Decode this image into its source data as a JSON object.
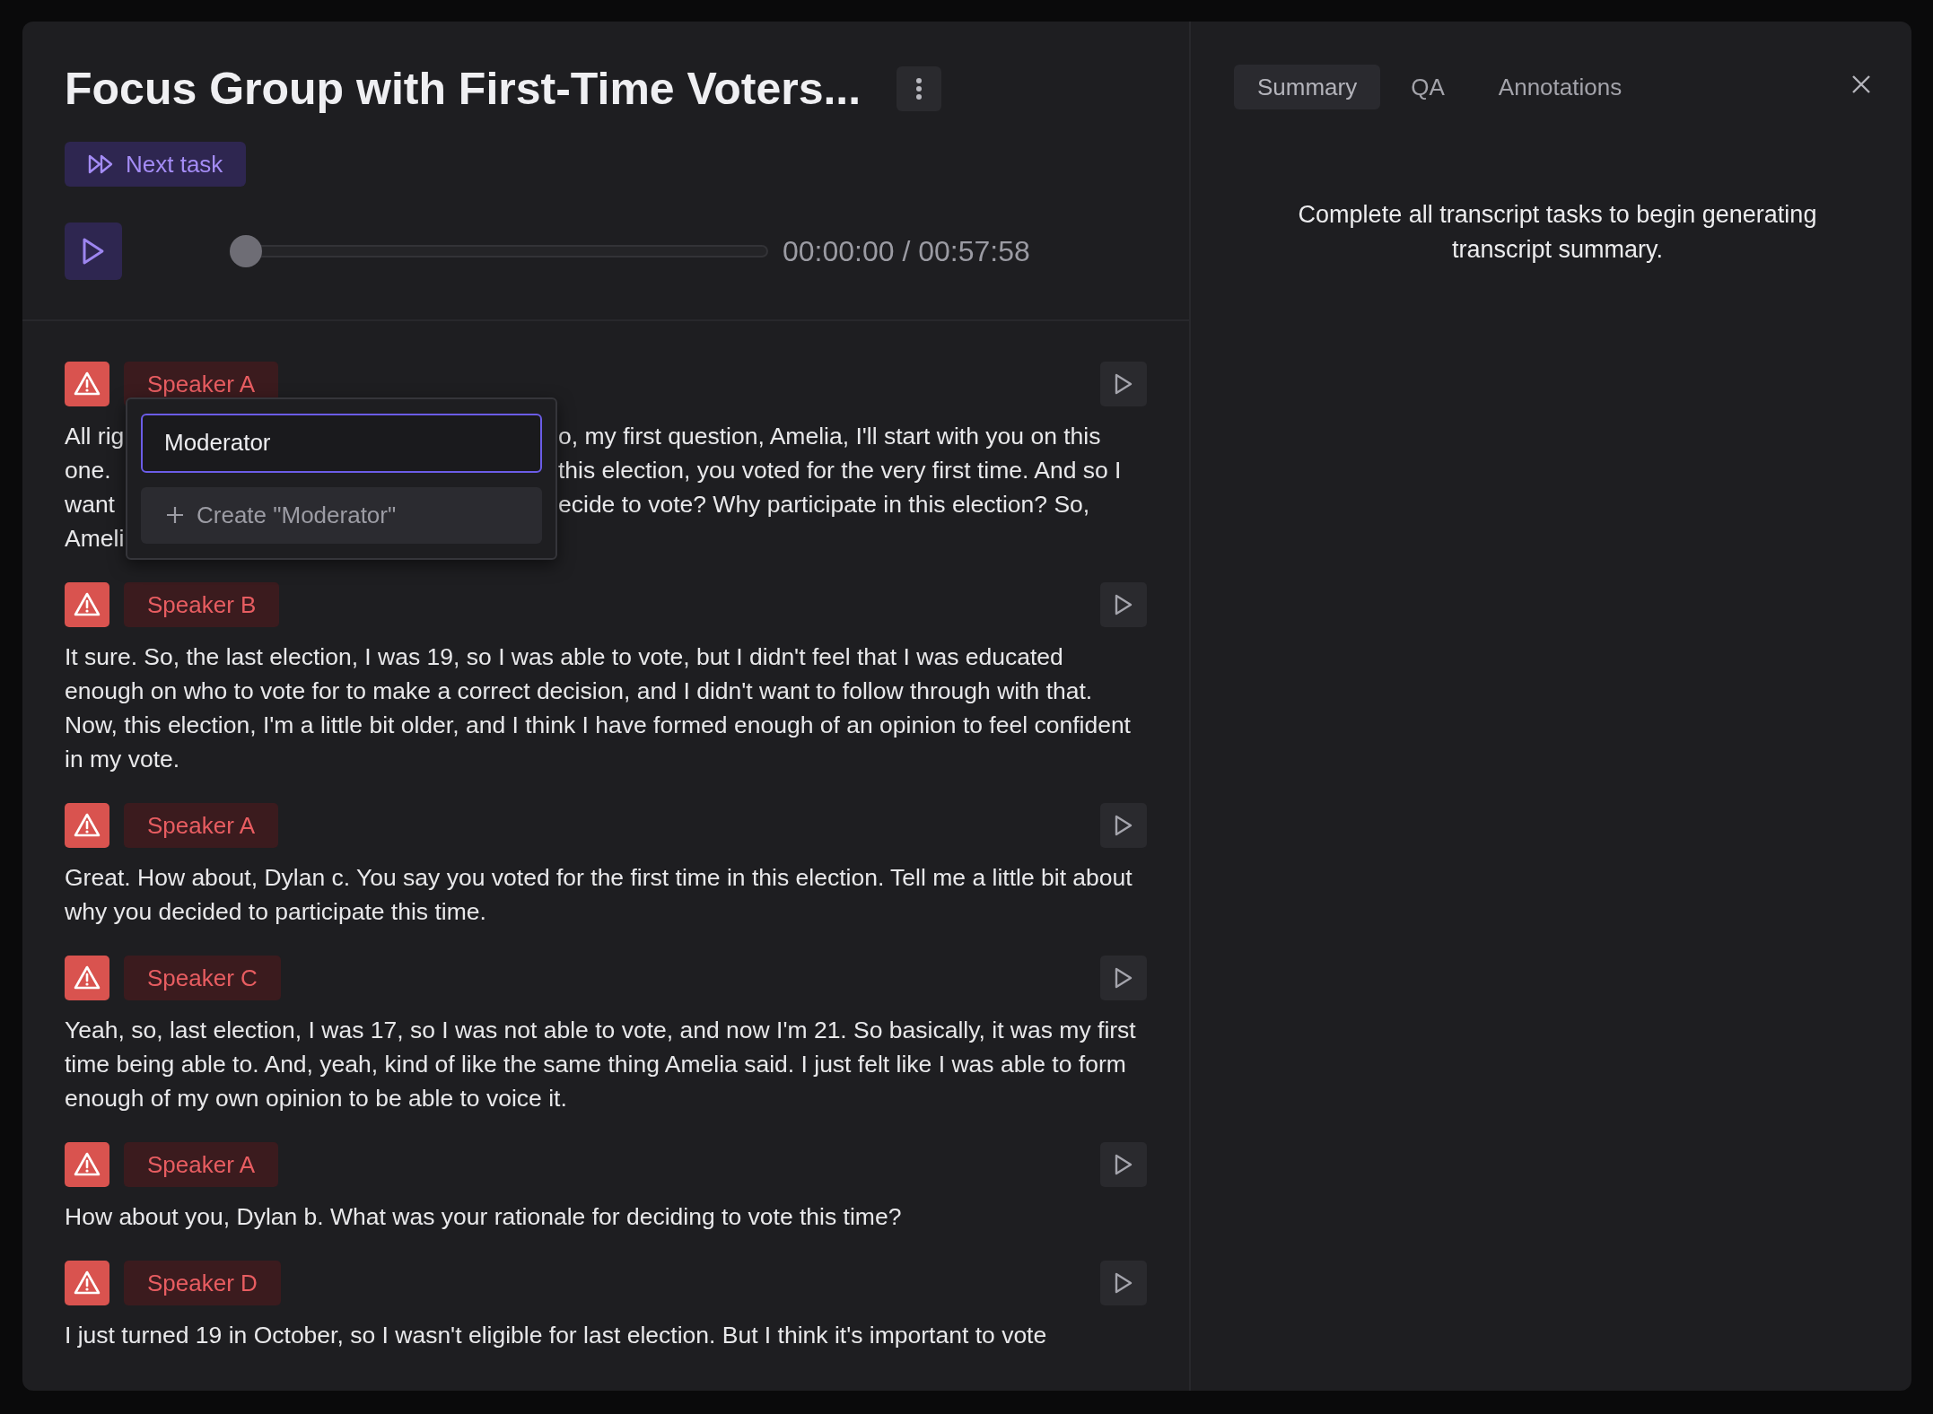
{
  "title": "Focus Group with First-Time Voters...",
  "next_task": "Next task",
  "player": {
    "level": 0,
    "time": "00:00:00 / 00:57:58"
  },
  "tabs": [
    {
      "label": "Summary",
      "selected": true
    },
    {
      "label": "QA",
      "selected": false
    },
    {
      "label": "Annotations",
      "selected": false
    }
  ],
  "summary_message": "Complete all transcript tasks to begin generating transcript summary.",
  "segments": [
    {
      "kind": "covered",
      "speaker": "Speaker A",
      "lines": [
        {
          "left": "All rig",
          "right": "o, my first question, Amelia, I'll start with you on this"
        },
        {
          "left": "one.",
          "right": "this election, you voted for the very first time. And so I"
        },
        {
          "left": "want",
          "right": "ecide to vote? Why participate in this election? So,"
        },
        {
          "left": "Ameli"
        }
      ]
    },
    {
      "kind": "plain",
      "speaker": "Speaker B",
      "text": "It sure. So, the last election, I was 19, so I was able to vote, but I didn't feel that I was educated enough on who to vote for to make a correct decision, and I didn't want to follow through with that. Now, this election, I'm a little bit older, and I think I have formed enough of an opinion to feel confident in my vote."
    },
    {
      "kind": "plain",
      "speaker": "Speaker A",
      "text": "Great. How about, Dylan c. You say you voted for the first time in this election. Tell me a little bit about why you decided to participate this time."
    },
    {
      "kind": "plain",
      "speaker": "Speaker C",
      "text": "Yeah, so, last election, I was 17, so I was not able to vote, and now I'm 21. So basically, it was my first time being able to. And, yeah, kind of like the same thing Amelia said. I just felt like I was able to form enough of my own opinion to be able to voice it."
    },
    {
      "kind": "plain",
      "speaker": "Speaker A",
      "text": "How about you, Dylan b. What was your rationale for deciding to vote this time?"
    },
    {
      "kind": "plain",
      "speaker": "Speaker D",
      "text": "I just turned 19 in October, so I wasn't eligible for last election. But I think it's important to vote"
    }
  ],
  "speaker_popup": {
    "value": "Moderator",
    "create_option": "Create \"Moderator\""
  }
}
